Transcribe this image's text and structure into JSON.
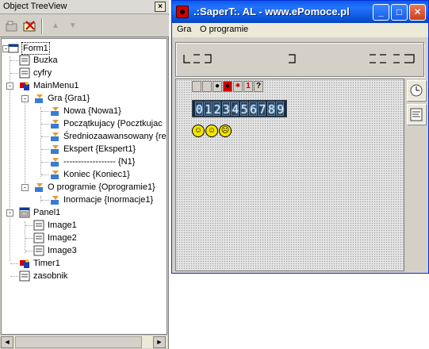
{
  "object_treeview": {
    "title": "Object TreeView",
    "close_label": "×",
    "toolbar": {
      "new_item_icon": "new-item-icon",
      "delete_icon": "delete-icon",
      "move_up_label": "▲",
      "move_down_label": "▼"
    },
    "nodes": [
      {
        "label": "Form1",
        "icon": "form-icon"
      },
      {
        "label": "Buzka",
        "icon": "component-icon"
      },
      {
        "label": "cyfry",
        "icon": "component-icon"
      },
      {
        "label": "MainMenu1",
        "icon": "mainmenu-icon"
      },
      {
        "label": "Gra {Gra1}",
        "icon": "menuitem-icon"
      },
      {
        "label": "Nowa {Nowa1}",
        "icon": "menuitem-icon"
      },
      {
        "label": "Początkujacy {Pocztkujac",
        "icon": "menuitem-icon"
      },
      {
        "label": "Średniozaawansowany {re",
        "icon": "menuitem-icon"
      },
      {
        "label": "Ekspert {Ekspert1}",
        "icon": "menuitem-icon"
      },
      {
        "label": "------------------ {N1}",
        "icon": "menuitem-icon"
      },
      {
        "label": "Koniec {Koniec1}",
        "icon": "menuitem-icon"
      },
      {
        "label": "O programie {Oprogramie1}",
        "icon": "menuitem-icon"
      },
      {
        "label": "Inormacje {Inormacje1}",
        "icon": "menuitem-icon"
      },
      {
        "label": "Panel1",
        "icon": "panel-icon"
      },
      {
        "label": "Image1",
        "icon": "image-icon"
      },
      {
        "label": "Image2",
        "icon": "image-icon"
      },
      {
        "label": "Image3",
        "icon": "image-icon"
      },
      {
        "label": "Timer1",
        "icon": "timer-icon"
      },
      {
        "label": "zasobnik",
        "icon": "component-icon"
      }
    ],
    "expanders": [
      "-",
      "-",
      "-",
      "-",
      "-"
    ],
    "scroll": {
      "left_label": "◄",
      "right_label": "►"
    }
  },
  "saper_window": {
    "title": ".:SaperT:.  AL - www.ePomoce.pl",
    "caption_buttons": {
      "minimize": "_",
      "maximize": "□",
      "close": "✕"
    },
    "menu": [
      "Gra",
      "O programie"
    ],
    "toolbar_strip": [
      "",
      "",
      "●",
      "●",
      "✷",
      "1",
      "?"
    ],
    "lcd_digits": [
      "0",
      "1",
      "2",
      "3",
      "4",
      "5",
      "6",
      "7",
      "8",
      "9"
    ],
    "faces": [
      "☺",
      "☺",
      "☹"
    ],
    "side_buttons": [
      "clock-icon",
      "list-icon"
    ],
    "colors": {
      "titlebar": "#0a5ae8",
      "close_button": "#c9401e",
      "lcd_background": "#1a2a3a",
      "face": "#f4e400"
    }
  }
}
